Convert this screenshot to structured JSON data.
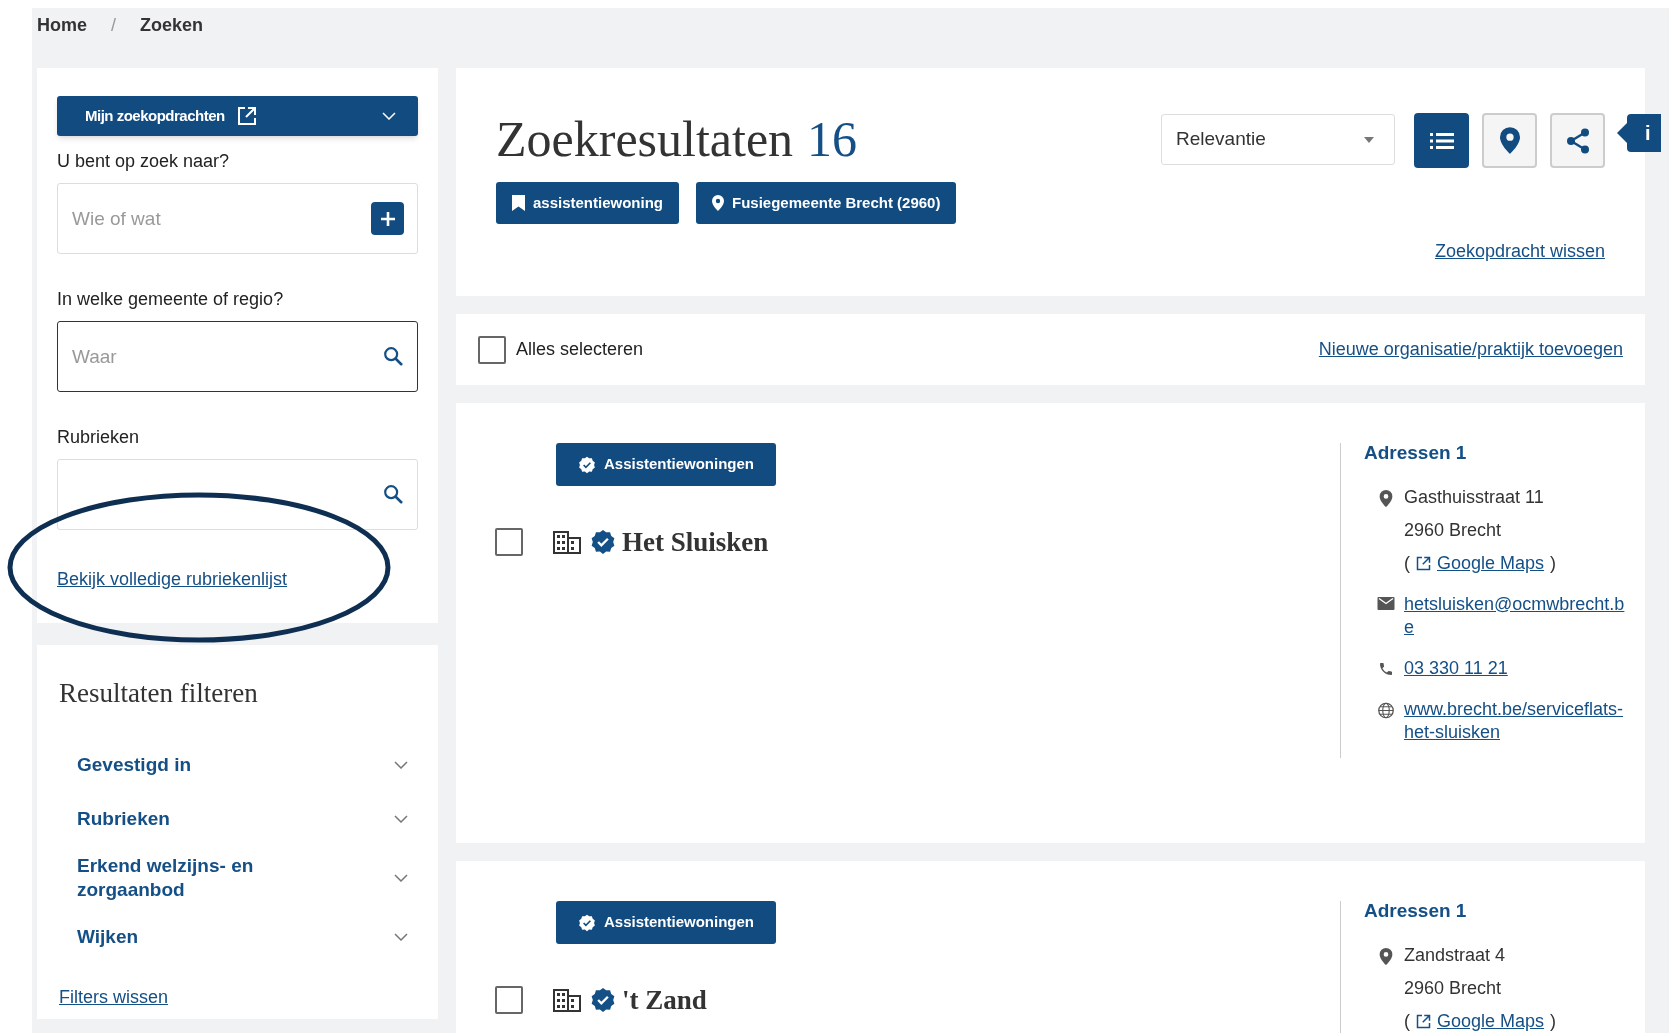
{
  "breadcrumb": {
    "separator": "/",
    "items": [
      {
        "label": "Home"
      },
      {
        "label": "Zoeken"
      }
    ]
  },
  "search_panel": {
    "saved_searches_button": "Mijn zoekopdrachten",
    "what": {
      "label": "U bent op zoek naar?",
      "placeholder": "Wie of wat"
    },
    "where": {
      "label": "In welke gemeente of regio?",
      "placeholder": "Waar"
    },
    "categories": {
      "label": "Rubrieken"
    },
    "full_list_link": "Bekijk volledige rubriekenlijst"
  },
  "filters": {
    "title": "Resultaten filteren",
    "groups": [
      {
        "label": "Gevestigd in",
        "expanded": false
      },
      {
        "label": "Rubrieken",
        "expanded": false
      },
      {
        "label": "Erkend welzijns- en zorgaanbod",
        "expanded": false
      },
      {
        "label": "Wijken",
        "expanded": false
      }
    ],
    "clear_link": "Filters wissen"
  },
  "results_header": {
    "title": "Zoekresultaten",
    "count": "16",
    "sort": "Relevantie",
    "views": [
      {
        "kind": "list",
        "selected": true
      },
      {
        "kind": "map",
        "selected": false
      }
    ],
    "active_filters": [
      {
        "kind": "category",
        "label": "assistentiewoning"
      },
      {
        "kind": "location",
        "label": "Fusiegemeente Brecht (2960)"
      }
    ],
    "clear_link": "Zoekopdracht wissen"
  },
  "select_all": {
    "label": "Alles selecteren",
    "checked": false
  },
  "add_link": "Nieuwe organisatie/praktijk toevoegen",
  "info_tab": "i",
  "results": [
    {
      "category": "Assistentiewoningen",
      "name": "Het Sluisken",
      "checked": false,
      "addresses_title": "Adressen 1",
      "contacts": [
        {
          "kind": "address",
          "lines": [
            "Gasthuisstraat 11",
            "2960 Brecht"
          ],
          "maps": {
            "before": "(",
            "link": "Google Maps",
            "after": ")"
          }
        },
        {
          "kind": "email",
          "text": "hetsluisken@ocmwbrecht.be"
        },
        {
          "kind": "phone",
          "text": "03 330 11 21"
        },
        {
          "kind": "website",
          "text": "www.brecht.be/serviceflats-het-sluisken"
        }
      ]
    },
    {
      "category": "Assistentiewoningen",
      "name": "'t Zand",
      "checked": false,
      "addresses_title": "Adressen 1",
      "contacts": [
        {
          "kind": "address",
          "lines": [
            "Zandstraat 4",
            "2960 Brecht"
          ],
          "maps": {
            "before": "(",
            "link": "Google Maps",
            "after": ")"
          }
        }
      ]
    }
  ]
}
